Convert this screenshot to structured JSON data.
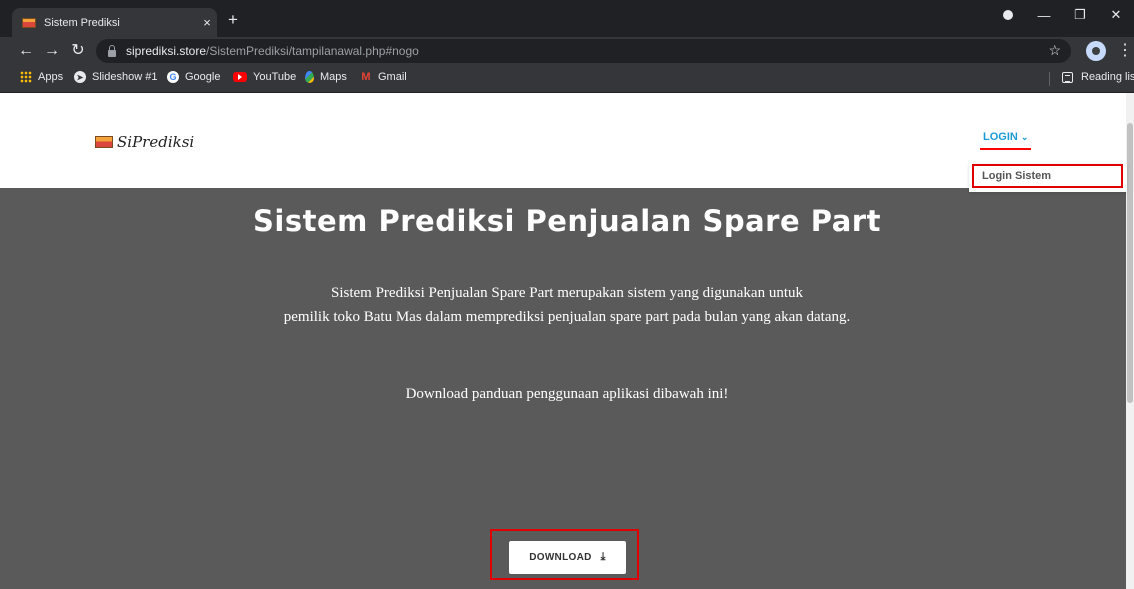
{
  "browser": {
    "tab_title": "Sistem Prediksi",
    "tab_close": "×",
    "new_tab": "+",
    "url_host": "siprediksi.store",
    "url_path": "/SistemPrediksi/tampilanawal.php#nogo",
    "bookmarks": [
      {
        "label": "Apps",
        "icon": "apps-icon"
      },
      {
        "label": "Slideshow #1",
        "icon": "slideshow-icon"
      },
      {
        "label": "Google",
        "icon": "google-icon"
      },
      {
        "label": "YouTube",
        "icon": "youtube-icon"
      },
      {
        "label": "Maps",
        "icon": "maps-icon"
      },
      {
        "label": "Gmail",
        "icon": "gmail-icon"
      }
    ],
    "reading_list": "Reading list"
  },
  "site": {
    "brand": "SiPrediksi",
    "nav": {
      "login": "LOGIN",
      "login_chevron": "⌄",
      "dropdown_item": "Login Sistem"
    },
    "hero": {
      "title": "Sistem Prediksi Penjualan Spare Part",
      "desc_line1": "Sistem Prediksi Penjualan Spare Part merupakan sistem yang digunakan untuk",
      "desc_line2": "pemilik toko Batu Mas dalam memprediksi penjualan spare part pada bulan yang akan datang.",
      "note": "Download panduan penggunaan aplikasi dibawah ini!",
      "download_label": "DOWNLOAD",
      "download_icon": "download-icon"
    }
  },
  "colors": {
    "hero_bg": "#5a5a5a",
    "nav_link": "#1e9bd7",
    "highlight": "#e00000"
  }
}
